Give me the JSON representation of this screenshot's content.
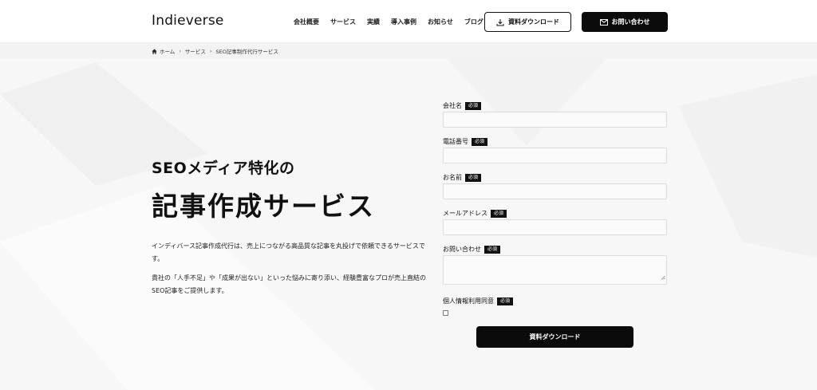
{
  "header": {
    "logo": "Indieverse",
    "nav": [
      {
        "label": "会社概要"
      },
      {
        "label": "サービス"
      },
      {
        "label": "実績"
      },
      {
        "label": "導入事例"
      },
      {
        "label": "お知らせ"
      },
      {
        "label": "ブログ"
      }
    ],
    "download_button": "資料ダウンロード",
    "contact_button": "お問い合わせ"
  },
  "breadcrumb": {
    "home": "ホーム",
    "service": "サービス",
    "current": "SEO記事制作代行サービス"
  },
  "hero": {
    "subtitle": "SEOメディア特化の",
    "title": "記事作成サービス",
    "text1": "インディバース記事作成代行は、売上につながる高品質な記事を丸投げで依頼できるサービスです。",
    "text2": "貴社の「人手不足」や「成果が出ない」といった悩みに寄り添い、経験豊富なプロが売上直結のSEO記事をご提供します。"
  },
  "form": {
    "required_badge": "必須",
    "fields": [
      {
        "label": "会社名",
        "value": ""
      },
      {
        "label": "電話番号",
        "value": ""
      },
      {
        "label": "お名前",
        "value": ""
      },
      {
        "label": "メールアドレス",
        "value": ""
      },
      {
        "label": "お問い合わせ",
        "value": ""
      },
      {
        "label": "個人情報利用同意",
        "checked": false
      }
    ],
    "submit": "資料ダウンロード"
  },
  "icons": {
    "download": "download-icon",
    "mail": "mail-icon",
    "home": "home-icon"
  }
}
